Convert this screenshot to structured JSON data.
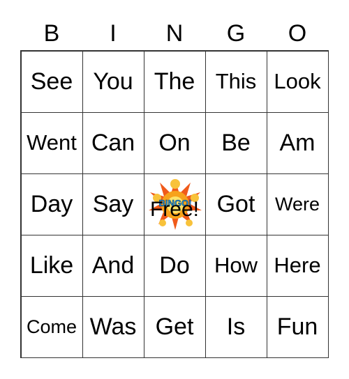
{
  "header": [
    "B",
    "I",
    "N",
    "G",
    "O"
  ],
  "cells": [
    [
      "See",
      "You",
      "The",
      "This",
      "Look"
    ],
    [
      "Went",
      "Can",
      "On",
      "Be",
      "Am"
    ],
    [
      "Day",
      "Say",
      "Free!",
      "Got",
      "Were"
    ],
    [
      "Like",
      "And",
      "Do",
      "How",
      "Here"
    ],
    [
      "Come",
      "Was",
      "Get",
      "Is",
      "Fun"
    ]
  ],
  "free_logo_text": "BINGO!",
  "free_icon": "bingo-explosion-icon"
}
